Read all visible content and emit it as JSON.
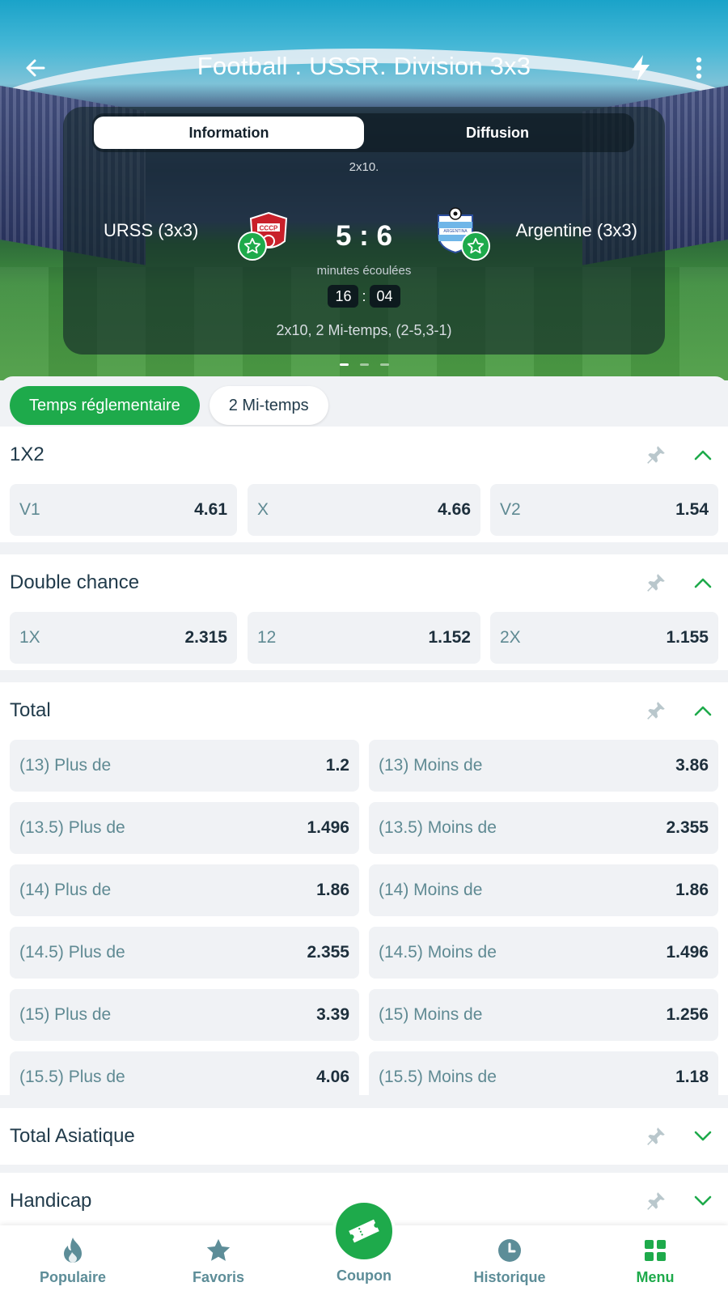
{
  "header": {
    "title": "Football . USSR. Division 3x3"
  },
  "match": {
    "tabs": [
      {
        "label": "Information",
        "active": true
      },
      {
        "label": "Diffusion",
        "active": false
      }
    ],
    "format_short": "2x10.",
    "team_home": "URSS (3x3)",
    "team_away": "Argentine (3x3)",
    "score": "5 : 6",
    "elapsed_label": "minutes écoulées",
    "timer_minutes": "16",
    "timer_seconds": "04",
    "format_detail": "2x10, 2 Mi-temps, (2-5,3-1)",
    "home_logo_text": "CCCP",
    "away_logo_text": "ARGENTINA"
  },
  "periods": [
    {
      "label": "Temps réglementaire",
      "active": true
    },
    {
      "label": "2 Mi-temps",
      "active": false
    }
  ],
  "markets": {
    "m1x2": {
      "title": "1X2",
      "expanded": true,
      "odds": [
        {
          "label": "V1",
          "value": "4.61"
        },
        {
          "label": "X",
          "value": "4.66"
        },
        {
          "label": "V2",
          "value": "1.54"
        }
      ]
    },
    "double_chance": {
      "title": "Double chance",
      "expanded": true,
      "odds": [
        {
          "label": "1X",
          "value": "2.315"
        },
        {
          "label": "12",
          "value": "1.152"
        },
        {
          "label": "2X",
          "value": "1.155"
        }
      ]
    },
    "total": {
      "title": "Total",
      "expanded": true,
      "rows": [
        {
          "over_label": "(13) Plus de",
          "over_value": "1.2",
          "under_label": "(13) Moins de",
          "under_value": "3.86"
        },
        {
          "over_label": "(13.5) Plus de",
          "over_value": "1.496",
          "under_label": "(13.5) Moins de",
          "under_value": "2.355"
        },
        {
          "over_label": "(14) Plus de",
          "over_value": "1.86",
          "under_label": "(14) Moins de",
          "under_value": "1.86"
        },
        {
          "over_label": "(14.5) Plus de",
          "over_value": "2.355",
          "under_label": "(14.5) Moins de",
          "under_value": "1.496"
        },
        {
          "over_label": "(15) Plus de",
          "over_value": "3.39",
          "under_label": "(15) Moins de",
          "under_value": "1.256"
        },
        {
          "over_label": "(15.5) Plus de",
          "over_value": "4.06",
          "under_label": "(15.5) Moins de",
          "under_value": "1.18"
        }
      ]
    },
    "total_asiatique": {
      "title": "Total Asiatique",
      "expanded": false
    },
    "handicap": {
      "title": "Handicap",
      "expanded": false
    }
  },
  "bottom_nav": {
    "items": [
      {
        "label": "Populaire",
        "icon": "flame-icon"
      },
      {
        "label": "Favoris",
        "icon": "star-icon"
      },
      {
        "label": "Coupon",
        "icon": "ticket-icon"
      },
      {
        "label": "Historique",
        "icon": "clock-icon"
      },
      {
        "label": "Menu",
        "icon": "grid-icon",
        "active": true
      }
    ]
  },
  "colors": {
    "accent_green": "#1eaa4b",
    "odd_label": "#5f8a93",
    "odd_value": "#1d2f3c",
    "nav_inactive": "#5d8d98"
  }
}
